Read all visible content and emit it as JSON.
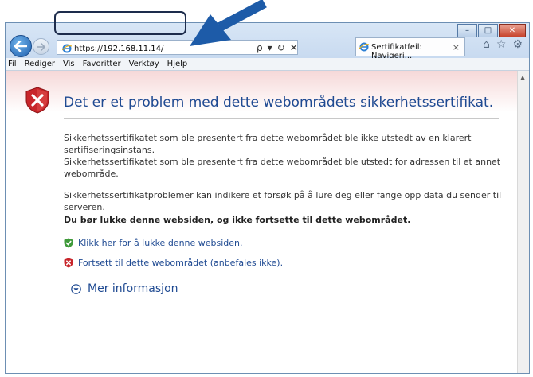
{
  "browser": {
    "url_prefix": "https://",
    "url_host": "192.168.11.14/",
    "address_tools": [
      "ρ",
      "▾",
      "↻",
      "✕"
    ],
    "tab_title": "Sertifikatfeil: Navigeri...",
    "tab_close": "×",
    "window_controls": {
      "minimize": "–",
      "maximize": "□",
      "close": "✕"
    },
    "right_icons": [
      "⌂",
      "☆",
      "⚙"
    ]
  },
  "menu": {
    "items": [
      "Fil",
      "Rediger",
      "Vis",
      "Favoritter",
      "Verktøy",
      "Hjelp"
    ]
  },
  "page": {
    "headline": "Det er et problem med dette webområdets sikkerhetssertifikat.",
    "para1": "Sikkerhetssertifikatet som ble presentert fra dette webområdet ble ikke utstedt av en klarert sertifiseringsinstans.",
    "para2": "Sikkerhetssertifikatet som ble presentert fra dette webområdet ble utstedt for adressen til et annet webområde.",
    "para3": "Sikkerhetssertifikatproblemer kan indikere et forsøk på å lure deg eller fange opp data du sender til serveren.",
    "bold": "Du bør lukke denne websiden, og ikke fortsette til dette webområdet.",
    "link_close": "Klikk her for å lukke denne websiden.",
    "link_continue": "Fortsett til dette webområdet (anbefales ikke).",
    "more_info": "Mer informasjon"
  },
  "colors": {
    "accent": "#1f4a92",
    "annotation_arrow": "#1d5ba8",
    "error_shield": "#c8262b",
    "ok_shield": "#3f9a3a"
  }
}
